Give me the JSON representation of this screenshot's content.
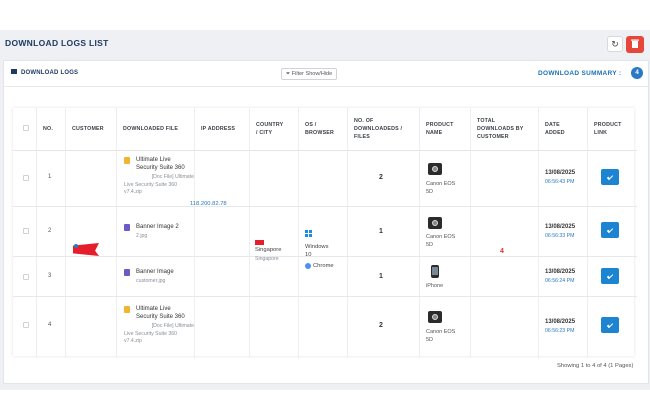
{
  "page": {
    "title": "DOWNLOAD LOGS LIST"
  },
  "card": {
    "title": "DOWNLOAD LOGS",
    "filter_label": "Filter Show/Hide",
    "summary_label": "DOWNLOAD SUMMARY :",
    "summary_count": "4"
  },
  "table": {
    "headers": {
      "no": "NO.",
      "customer": "CUSTOMER",
      "downloaded_file": "DOWNLOADED FILE",
      "ip": "IP ADDRESS",
      "country_1": "COUNTRY",
      "country_2": "/ CITY",
      "os_1": "OS /",
      "os_2": "BROWSER",
      "count_1": "NO. OF",
      "count_2": "DOWNLOADEDS /",
      "count_3": "FILES",
      "product_1": "PRODUCT",
      "product_2": "NAME",
      "total_1": "TOTAL",
      "total_2": "DOWNLOADS BY",
      "total_3": "CUSTOMER",
      "date_1": "DATE",
      "date_2": "ADDED",
      "link_1": "PRODUCT",
      "link_2": "LINK"
    },
    "rows": [
      {
        "no": "1",
        "file_l1": "Ultimate Live",
        "file_l2": "Security Suite 360",
        "sub_l1": "[Doc File] Ultimate",
        "sub_l2": "Live Security Suite 360",
        "sub_l3": "v7.4.zip",
        "count": "2",
        "product_l1": "Canon EOS",
        "product_l2": "5D",
        "date": "13/08/2025",
        "time": "06:56:43 PM"
      },
      {
        "no": "2",
        "file_l1": "Banner Image 2",
        "sub_l1": "2.jpg",
        "count": "1",
        "product_l1": "Canon EOS",
        "product_l2": "5D",
        "date": "13/08/2025",
        "time": "06:56:33 PM"
      },
      {
        "no": "3",
        "file_l1": "Banner Image",
        "sub_l1": "customer.jpg",
        "count": "1",
        "product_l1": "iPhone",
        "date": "13/08/2025",
        "time": "06:56:24 PM"
      },
      {
        "no": "4",
        "file_l1": "Ultimate Live",
        "file_l2": "Security Suite 360",
        "sub_l1": "[Doc File] Ultimate",
        "sub_l2": "Live Security Suite 360",
        "sub_l3": "v7.4.zip",
        "count": "2",
        "product_l1": "Canon EOS",
        "product_l2": "5D",
        "date": "13/08/2025",
        "time": "06:56:23 PM"
      }
    ],
    "shared": {
      "ip": "118.200.82.78",
      "country": "Singapore",
      "city": "Singapore",
      "os_l1": "Windows",
      "os_l2": "10",
      "browser": "Chrome",
      "total": "4"
    }
  },
  "footer": {
    "text": "Showing 1 to 4 of 4 (1 Pages)"
  },
  "colors": {
    "accent": "#2a79c5",
    "danger": "#e7473b",
    "title": "#1f3b63",
    "total": "#d9362b"
  }
}
